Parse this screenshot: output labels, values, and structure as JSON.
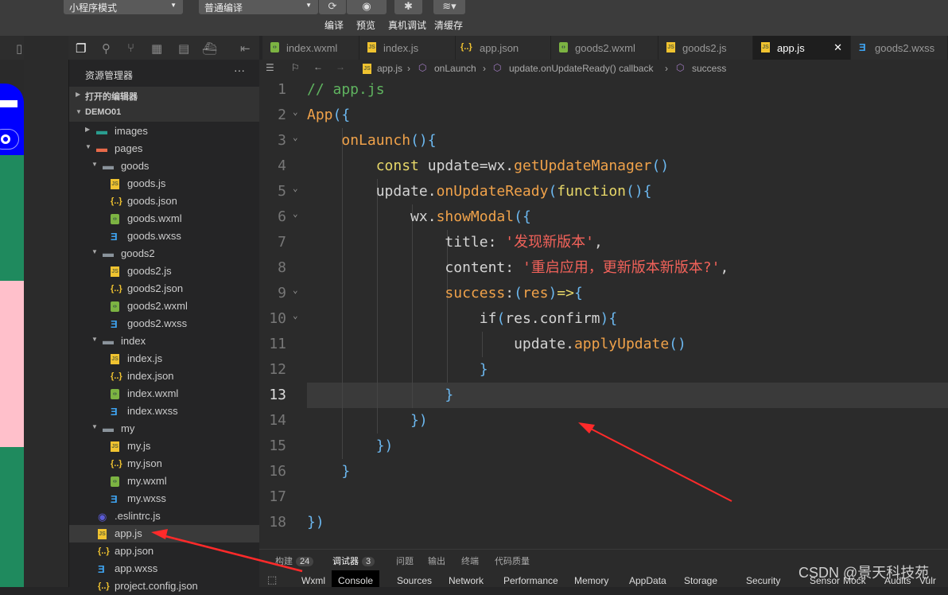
{
  "toolbar": {
    "mode": "小程序模式",
    "compile_mode": "普通编译",
    "compile": "编译",
    "preview": "预览",
    "real_debug": "真机调试",
    "clear_cache": "清缓存"
  },
  "tabs": [
    {
      "label": "index.wxml",
      "type": "wxml"
    },
    {
      "label": "index.js",
      "type": "js"
    },
    {
      "label": "app.json",
      "type": "json"
    },
    {
      "label": "goods2.wxml",
      "type": "wxml"
    },
    {
      "label": "goods2.js",
      "type": "js"
    },
    {
      "label": "app.js",
      "type": "js",
      "active": true
    },
    {
      "label": "goods2.wxss",
      "type": "wxss"
    }
  ],
  "sidebar": {
    "title": "资源管理器",
    "more": "···",
    "open_editors": "打开的编辑器",
    "project": "DEMO01",
    "items": [
      {
        "label": "images",
        "depth": 0,
        "type": "folder-img",
        "expand": "closed"
      },
      {
        "label": "pages",
        "depth": 0,
        "type": "folder-pages",
        "expand": "open"
      },
      {
        "label": "goods",
        "depth": 1,
        "type": "folder",
        "expand": "open"
      },
      {
        "label": "goods.js",
        "depth": 2,
        "type": "js"
      },
      {
        "label": "goods.json",
        "depth": 2,
        "type": "json"
      },
      {
        "label": "goods.wxml",
        "depth": 2,
        "type": "wxml"
      },
      {
        "label": "goods.wxss",
        "depth": 2,
        "type": "wxss"
      },
      {
        "label": "goods2",
        "depth": 1,
        "type": "folder",
        "expand": "open"
      },
      {
        "label": "goods2.js",
        "depth": 2,
        "type": "js"
      },
      {
        "label": "goods2.json",
        "depth": 2,
        "type": "json"
      },
      {
        "label": "goods2.wxml",
        "depth": 2,
        "type": "wxml"
      },
      {
        "label": "goods2.wxss",
        "depth": 2,
        "type": "wxss"
      },
      {
        "label": "index",
        "depth": 1,
        "type": "folder",
        "expand": "open"
      },
      {
        "label": "index.js",
        "depth": 2,
        "type": "js"
      },
      {
        "label": "index.json",
        "depth": 2,
        "type": "json"
      },
      {
        "label": "index.wxml",
        "depth": 2,
        "type": "wxml"
      },
      {
        "label": "index.wxss",
        "depth": 2,
        "type": "wxss"
      },
      {
        "label": "my",
        "depth": 1,
        "type": "folder",
        "expand": "open"
      },
      {
        "label": "my.js",
        "depth": 2,
        "type": "js"
      },
      {
        "label": "my.json",
        "depth": 2,
        "type": "json"
      },
      {
        "label": "my.wxml",
        "depth": 2,
        "type": "wxml"
      },
      {
        "label": "my.wxss",
        "depth": 2,
        "type": "wxss"
      },
      {
        "label": ".eslintrc.js",
        "depth": 0,
        "type": "eslint"
      },
      {
        "label": "app.js",
        "depth": 0,
        "type": "js",
        "selected": true
      },
      {
        "label": "app.json",
        "depth": 0,
        "type": "json"
      },
      {
        "label": "app.wxss",
        "depth": 0,
        "type": "wxss"
      },
      {
        "label": "project.config.json",
        "depth": 0,
        "type": "json"
      }
    ]
  },
  "breadcrumb": [
    "app.js",
    "onLaunch",
    "update.onUpdateReady() callback",
    "success"
  ],
  "code": {
    "current_line": 13,
    "lines": [
      [
        [
          "com",
          "// app.js"
        ]
      ],
      [
        [
          "fn",
          "App"
        ],
        [
          "br",
          "({"
        ]
      ],
      [
        [
          "p",
          "    "
        ],
        [
          "fn",
          "onLaunch"
        ],
        [
          "br",
          "(){"
        ]
      ],
      [
        [
          "p",
          "        "
        ],
        [
          "kw",
          "const"
        ],
        [
          "id",
          " update=wx."
        ],
        [
          "fn",
          "getUpdateManager"
        ],
        [
          "br",
          "()"
        ]
      ],
      [
        [
          "p",
          "        "
        ],
        [
          "id",
          "update."
        ],
        [
          "fn",
          "onUpdateReady"
        ],
        [
          "br",
          "("
        ],
        [
          "kw",
          "function"
        ],
        [
          "br",
          "(){"
        ]
      ],
      [
        [
          "p",
          "            "
        ],
        [
          "id",
          "wx."
        ],
        [
          "fn",
          "showModal"
        ],
        [
          "br",
          "({"
        ]
      ],
      [
        [
          "p",
          "                "
        ],
        [
          "id",
          "title: "
        ],
        [
          "str",
          "'发现新版本'"
        ],
        [
          "id",
          ","
        ]
      ],
      [
        [
          "p",
          "                "
        ],
        [
          "id",
          "content: "
        ],
        [
          "str",
          "'重启应用，更新版本新版本?'"
        ],
        [
          "id",
          ","
        ]
      ],
      [
        [
          "p",
          "                "
        ],
        [
          "fn",
          "success"
        ],
        [
          "id",
          ":"
        ],
        [
          "br",
          "("
        ],
        [
          "fn",
          "res"
        ],
        [
          "br",
          ")"
        ],
        [
          "kw",
          "=>"
        ],
        [
          "br",
          "{"
        ]
      ],
      [
        [
          "p",
          "                    "
        ],
        [
          "id",
          "if"
        ],
        [
          "br",
          "("
        ],
        [
          "id",
          "res.confirm"
        ],
        [
          "br",
          ")"
        ],
        [
          "br",
          "{"
        ]
      ],
      [
        [
          "p",
          "                        "
        ],
        [
          "id",
          "update."
        ],
        [
          "fn",
          "applyUpdate"
        ],
        [
          "br",
          "()"
        ]
      ],
      [
        [
          "p",
          "                    "
        ],
        [
          "br",
          "}"
        ]
      ],
      [
        [
          "p",
          "                "
        ],
        [
          "br",
          "}"
        ]
      ],
      [
        [
          "p",
          "            "
        ],
        [
          "br",
          "})"
        ]
      ],
      [
        [
          "p",
          "        "
        ],
        [
          "br",
          "})"
        ]
      ],
      [
        [
          "p",
          "    "
        ],
        [
          "br",
          "}"
        ]
      ],
      [],
      [
        [
          "br",
          "})"
        ]
      ]
    ],
    "folds": [
      2,
      3,
      5,
      6,
      9,
      10
    ]
  },
  "panel": {
    "tabs": [
      {
        "label": "构建",
        "badge": "24"
      },
      {
        "label": "调试器",
        "badge": "3",
        "active": true
      },
      {
        "label": "问题"
      },
      {
        "label": "输出"
      },
      {
        "label": "终端"
      },
      {
        "label": "代码质量"
      }
    ]
  },
  "devtools": {
    "tabs": [
      "Wxml",
      "Console",
      "Sources",
      "Network",
      "Performance",
      "Memory",
      "AppData",
      "Storage",
      "Security",
      "Sensor",
      "Mock",
      "Audits",
      "Vulr"
    ],
    "active": "Console"
  },
  "watermark": "CSDN @景天科技苑",
  "colors": {
    "annotation_arrow": "#ff2a2a",
    "sim_nav": "#0000ff",
    "sim_green": "#1f8a5e",
    "sim_pink": "#ffc0cb"
  }
}
